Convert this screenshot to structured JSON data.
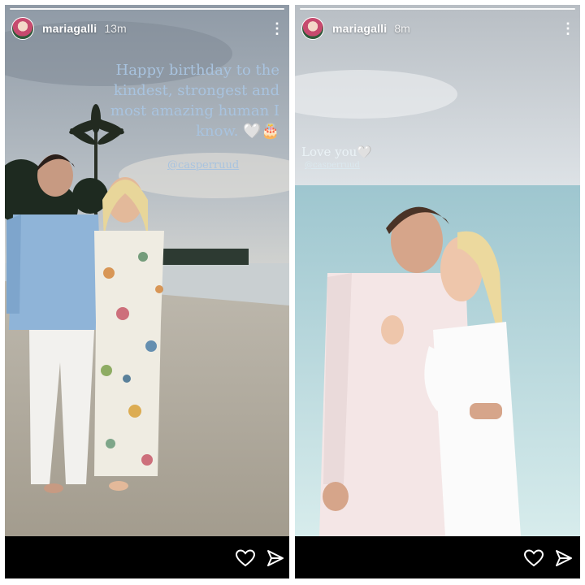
{
  "stories": [
    {
      "username": "mariagalli",
      "time": "13m",
      "caption": "Happy birthday to the kindest, strongest and most amazing human I know. 🤍🎂",
      "mention": "@casperruud",
      "icons": [
        "more-options-icon",
        "heart-icon",
        "send-icon"
      ]
    },
    {
      "username": "mariagalli",
      "time": "8m",
      "caption": "Love you🤍",
      "mention": "@casperruud",
      "icons": [
        "more-options-icon",
        "heart-icon",
        "send-icon"
      ]
    }
  ]
}
